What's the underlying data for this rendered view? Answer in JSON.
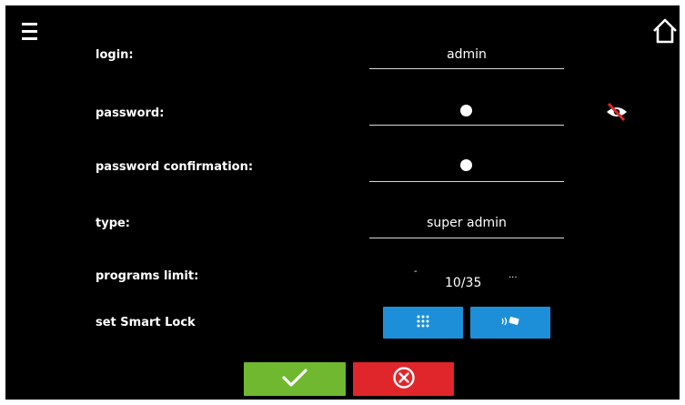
{
  "menu_icon": "hamburger-menu-icon",
  "home_icon": "home-icon",
  "fields": {
    "login": {
      "label": "login:",
      "value": "admin"
    },
    "password": {
      "label": "password:",
      "visibility_icon": "eye-slash-icon"
    },
    "password_confirmation": {
      "label": "password confirmation:"
    },
    "type": {
      "label": "type:",
      "value": "super admin"
    },
    "programs_limit": {
      "label": "programs limit:",
      "value": "10/35",
      "decrement": "-",
      "increment": "..."
    },
    "smart_lock": {
      "label": "set Smart Lock",
      "keypad_icon": "keypad-icon",
      "rfid_icon": "rfid-card-icon"
    }
  },
  "actions": {
    "confirm_icon": "checkmark-icon",
    "cancel_icon": "cancel-circle-icon"
  },
  "colors": {
    "confirm": "#6fb82f",
    "cancel": "#e0262a",
    "accent": "#1d8fd8"
  }
}
